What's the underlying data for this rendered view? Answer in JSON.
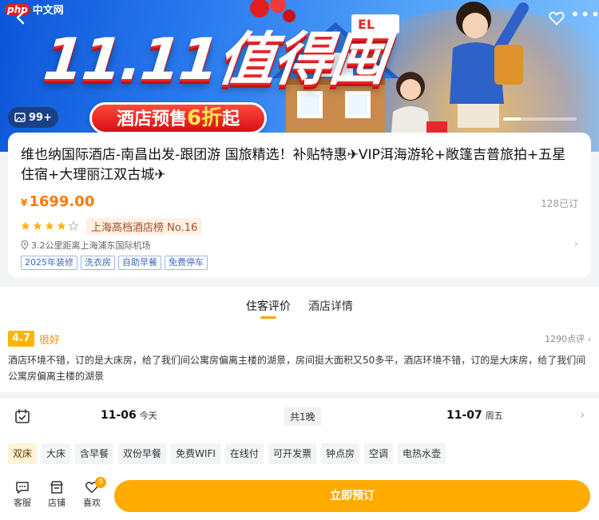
{
  "logo": {
    "badge": "php",
    "text": "中文网"
  },
  "banner": {
    "promo_title": "11.11值得囤",
    "promo_sub_prefix": "酒店预售",
    "promo_sub_highlight": "6折",
    "promo_sub_suffix": "起",
    "photo_count": "99+",
    "slide_count": 1
  },
  "hotel": {
    "title": "维也纳国际酒店-南昌出发-跟团游 国旅精选！补贴特惠✈VIP洱海游轮+敞篷吉普旅拍+五星住宿+大理丽江双古城✈",
    "currency": "¥",
    "price": "1699.00",
    "booked": "128已订",
    "star_rating": 4,
    "star_max": 5,
    "rank_tag": "上海高档酒店榜 No.16",
    "location": "3.2公里距离上海浦东国际机场",
    "tags": [
      "2025年装修",
      "洗衣房",
      "自助早餐",
      "免费停车"
    ]
  },
  "tabs": [
    {
      "label": "住客评价",
      "active": true
    },
    {
      "label": "酒店详情",
      "active": false
    }
  ],
  "reviews": {
    "score": "4.7",
    "score_text": "很好",
    "count": "1290点评",
    "excerpt": "酒店环境不错，订的是大床房，给了我们间公寓房偏离主楼的湖景，房间挺大面积又50多平，酒店环境不错，订的是大床房，给了我们间公寓房偏离主楼的湖景"
  },
  "dates": {
    "checkin_date": "11-06",
    "checkin_day": "今天",
    "nights": "共1晚",
    "checkout_date": "11-07",
    "checkout_day": "周五"
  },
  "filters": [
    "双床",
    "大床",
    "含早餐",
    "双份早餐",
    "免费WIFI",
    "在线付",
    "可开发票",
    "钟点房",
    "空调",
    "电热水壶"
  ],
  "bottom_bar": {
    "service": "客服",
    "store": "店铺",
    "favorite": "喜欢",
    "favorite_badge": "9",
    "book": "立即预订"
  },
  "colors": {
    "accent": "#ffa500",
    "price": "#ff7a00",
    "promo_red": "#e8262b",
    "tag_blue": "#3b6ab8"
  }
}
